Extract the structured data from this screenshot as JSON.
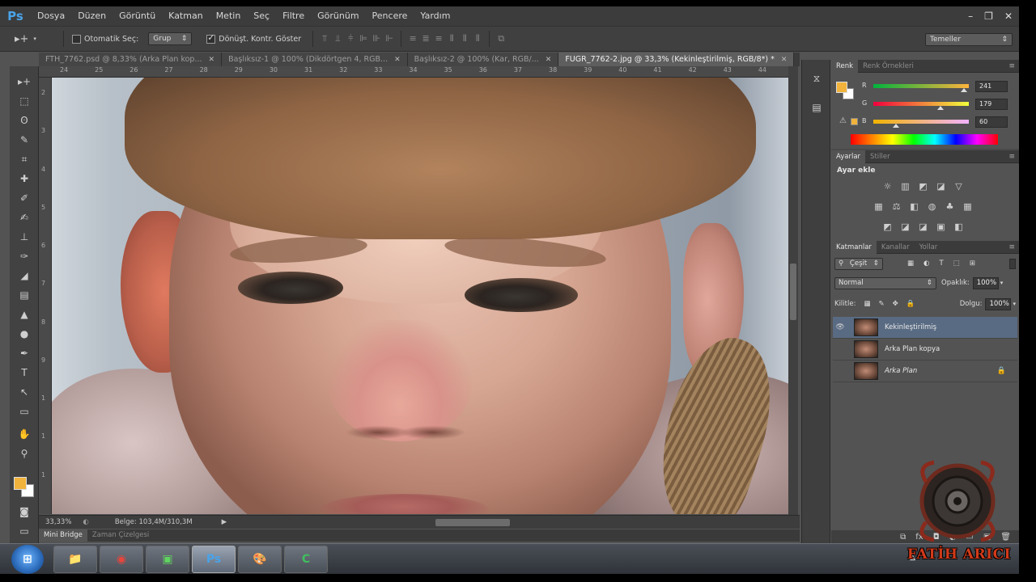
{
  "app": {
    "logo": "Ps"
  },
  "menu": [
    "Dosya",
    "Düzen",
    "Görüntü",
    "Katman",
    "Metin",
    "Seç",
    "Filtre",
    "Görünüm",
    "Pencere",
    "Yardım"
  ],
  "window_controls": {
    "minimize": "–",
    "restore": "❐",
    "close": "✕"
  },
  "options": {
    "tool_glyph": "▸+",
    "auto_select_label": "Otomatik Seç:",
    "auto_select_value": "Grup",
    "transform_label": "Dönüşt. Kontr. Göster",
    "workspace": "Temeller"
  },
  "tabs": [
    {
      "label": "FTH_7762.psd @ 8,33% (Arka Plan kop...",
      "close": "✕"
    },
    {
      "label": "Başlıksız-1 @ 100% (Dikdörtgen 4, RGB...",
      "close": "✕"
    },
    {
      "label": "Başlıksız-2 @ 100% (Kar, RGB/...",
      "close": "✕"
    },
    {
      "label": "FUGR_7762-2.jpg @ 33,3% (Kekinleştirilmiş, RGB/8*) *",
      "close": "✕"
    }
  ],
  "ruler_top": [
    "24",
    "25",
    "26",
    "27",
    "28",
    "29",
    "30",
    "31",
    "32",
    "33",
    "34",
    "35",
    "36",
    "37",
    "38",
    "39",
    "40",
    "41",
    "42",
    "43",
    "44"
  ],
  "ruler_left": [
    "2",
    "3",
    "4",
    "5",
    "6",
    "7",
    "8",
    "9",
    "1",
    "1",
    "1"
  ],
  "status": {
    "zoom": "33,33%",
    "doc": "Belge: 103,4M/310,3M",
    "arrow": "▶"
  },
  "bottom_tabs": [
    "Mini Bridge",
    "Zaman Çizelgesi"
  ],
  "tools": [
    "▸+",
    "⬚",
    "ʘ",
    "✎",
    "⌗",
    "✚",
    "✐",
    "✍",
    "⊥",
    "✑",
    "◢",
    "▤",
    "▲",
    "●",
    "✒",
    "T",
    "↖",
    "▭",
    "✋",
    "⚲"
  ],
  "color_panel": {
    "tabs": [
      "Renk",
      "Renk Örnekleri"
    ],
    "channels": [
      {
        "name": "R",
        "value": "241",
        "level": 0.945,
        "gradient": "linear-gradient(90deg,#00b33c,#ffb33c)"
      },
      {
        "name": "G",
        "value": "179",
        "level": 0.702,
        "gradient": "linear-gradient(90deg,#f1003c,#f1ff3c)"
      },
      {
        "name": "B",
        "value": "60",
        "level": 0.235,
        "gradient": "linear-gradient(90deg,#f1b300,#f1b3ff)"
      }
    ],
    "warning_glyph": "⚠",
    "fg_color": "#f1b33c",
    "bg_color": "#ffffff"
  },
  "adjustments": {
    "tabs": [
      "Ayarlar",
      "Stiller"
    ],
    "title": "Ayar ekle",
    "rows": [
      [
        "☼",
        "▥",
        "◩",
        "◪",
        "▽"
      ],
      [
        "▦",
        "⚖",
        "◧",
        "◍",
        "♣",
        "▦"
      ],
      [
        "◩",
        "◪",
        "◪",
        "▣",
        "◧"
      ]
    ]
  },
  "layers": {
    "tabs": [
      "Katmanlar",
      "Kanallar",
      "Yollar"
    ],
    "filter": "Çeşit",
    "filter_icons": [
      "▦",
      "◐",
      "T",
      "⬚",
      "⊞"
    ],
    "blend": "Normal",
    "opacity_label": "Opaklık:",
    "opacity": "100%",
    "lock_label": "Kilitle:",
    "lock_icons": [
      "▦",
      "✎",
      "✥",
      "🔒"
    ],
    "fill_label": "Dolgu:",
    "fill": "100%",
    "items": [
      {
        "name": "Kekinleştirilmiş",
        "visible": true,
        "selected": true,
        "eye": "👁",
        "lock": ""
      },
      {
        "name": "Arka Plan kopya",
        "visible": false,
        "selected": false,
        "eye": "",
        "lock": ""
      },
      {
        "name": "Arka Plan",
        "visible": false,
        "selected": false,
        "eye": "",
        "lock": "🔒"
      }
    ],
    "bottom_icons": [
      "⧉",
      "fx",
      "◘",
      "◐",
      "▭",
      "▣",
      "🗑"
    ]
  },
  "taskbar": {
    "start": "⊞",
    "apps": [
      {
        "name": "explorer",
        "glyph": "📁"
      },
      {
        "name": "chrome",
        "glyph": "◉"
      },
      {
        "name": "app-green",
        "glyph": "▣"
      },
      {
        "name": "photoshop",
        "glyph": "Ps"
      },
      {
        "name": "paint",
        "glyph": "🎨"
      },
      {
        "name": "camtasia",
        "glyph": "C"
      }
    ],
    "tray_arrow": "▲"
  },
  "watermark": {
    "text": "FATİH ARICI"
  }
}
